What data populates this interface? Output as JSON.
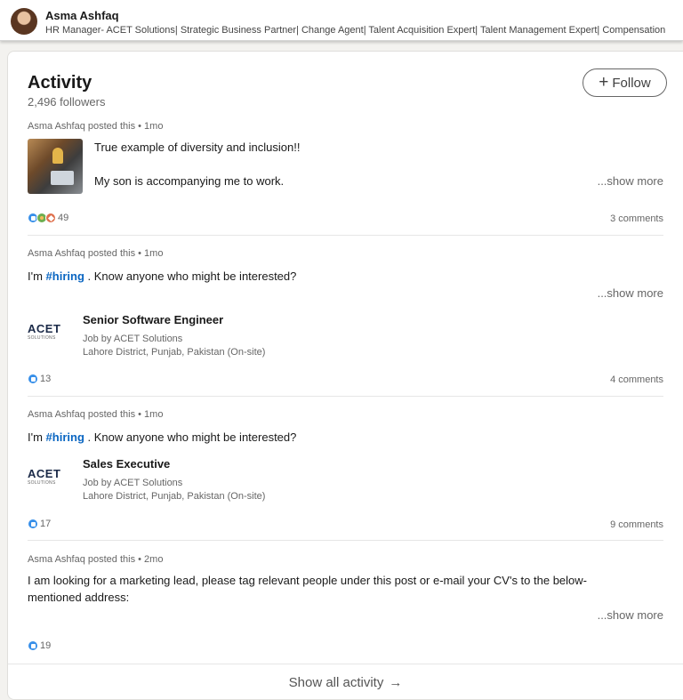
{
  "profile": {
    "name": "Asma Ashfaq",
    "headline": "HR Manager- ACET Solutions| Strategic Business Partner| Change Agent| Talent Acquisition Expert| Talent Management Expert| Compensation"
  },
  "activity": {
    "title": "Activity",
    "followers": "2,496 followers",
    "follow_label": "Follow"
  },
  "posts": [
    {
      "meta": "Asma Ashfaq posted this • 1mo",
      "line1": "True example of diversity and inclusion!!",
      "line2": "My son is accompanying me to work.",
      "show_more": "...show more",
      "reactions": "49",
      "comments": "3 comments"
    },
    {
      "meta": "Asma Ashfaq posted this • 1mo",
      "text_pre": "I'm ",
      "hashtag": "#hiring",
      "text_post": " . Know anyone who might be interested?",
      "show_more": "...show more",
      "job": {
        "logo": "ACET",
        "logo_sub": "SOLUTIONS",
        "title": "Senior Software Engineer",
        "company": "Job by ACET Solutions",
        "location": "Lahore District, Punjab, Pakistan (On-site)"
      },
      "reactions": "13",
      "comments": "4 comments"
    },
    {
      "meta": "Asma Ashfaq posted this • 1mo",
      "text_pre": "I'm ",
      "hashtag": "#hiring",
      "text_post": " . Know anyone who might be interested?",
      "job": {
        "logo": "ACET",
        "logo_sub": "SOLUTIONS",
        "title": "Sales Executive",
        "company": "Job by ACET Solutions",
        "location": "Lahore District, Punjab, Pakistan (On-site)"
      },
      "reactions": "17",
      "comments": "9 comments"
    },
    {
      "meta": "Asma Ashfaq posted this • 2mo",
      "text": "I am looking for a marketing lead, please tag relevant people under this post or e-mail your CV's to the below-mentioned address:",
      "show_more": "...show more",
      "reactions": "19"
    }
  ],
  "show_all": "Show all activity",
  "show_all_arrow": "→",
  "colors": {
    "link_blue": "#0a66c2",
    "like_blue": "#378fe9",
    "text_muted": "#666666"
  }
}
